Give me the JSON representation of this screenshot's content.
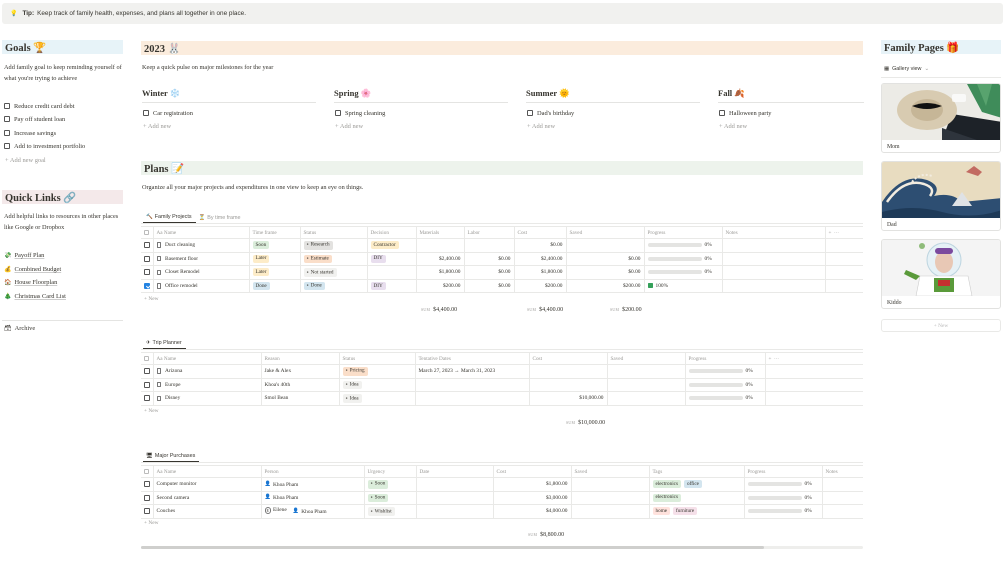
{
  "tip": {
    "icon": "💡",
    "label": "Tip:",
    "text": "Keep track of family health, expenses, and plans all together in one place."
  },
  "goals": {
    "title": "Goals 🏆",
    "description": "Add family goal to keep reminding yourself of what you're trying to achieve",
    "items": [
      "Reduce credit card debt",
      "Pay off student loan",
      "Increase savings",
      "Add to investment portfolio"
    ],
    "new_label": "+ Add new goal"
  },
  "quick_links": {
    "title": "Quick Links 🔗",
    "description": "Add helpful links to resources in other places like Google or Dropbox",
    "links": [
      {
        "icon": "💸",
        "label": "Payoff Plan"
      },
      {
        "icon": "💰",
        "label": "Combined Budget"
      },
      {
        "icon": "🏠",
        "label": "House Floorplan"
      },
      {
        "icon": "🎄",
        "label": "Christmas Card List"
      }
    ],
    "archive": {
      "icon": "🗃",
      "label": "Archive"
    }
  },
  "year": {
    "title": "2023 🐰",
    "description": "Keep a quick pulse on major milestones for the year",
    "seasons": [
      {
        "name": "Winter ❄️",
        "item": "Car registration",
        "add": "+ Add new"
      },
      {
        "name": "Spring 🌸",
        "item": "Spring cleaning",
        "add": "+ Add new"
      },
      {
        "name": "Summer 🌞",
        "item": "Dad's birthday",
        "add": "+ Add new"
      },
      {
        "name": "Fall 🍂",
        "item": "Halloween party",
        "add": "+ Add new"
      }
    ]
  },
  "plans": {
    "title": "Plans 📝",
    "description": "Organize all your major projects and expenditures in one view to keep an eye on things.",
    "tabs": [
      "Family Projects",
      "By time frame"
    ],
    "headers": [
      "Aa Name",
      "Time frame",
      "Status",
      "Decision",
      "Materials",
      "Labor",
      "Cost",
      "Saved",
      "Progress",
      "Notes"
    ],
    "rows": [
      {
        "name": "Duct cleaning",
        "time": "Soon",
        "status": "Research",
        "decision": "Contractor",
        "materials": "",
        "labor": "",
        "cost": "$0.00",
        "saved": "",
        "progress": "0%",
        "pct": 0,
        "checked": false
      },
      {
        "name": "Basement floor",
        "time": "Later",
        "status": "Estimate",
        "decision": "DIY",
        "materials": "$2,400.00",
        "labor": "$0.00",
        "cost": "$2,400.00",
        "saved": "$0.00",
        "progress": "0%",
        "pct": 0,
        "checked": false
      },
      {
        "name": "Closet Remodel",
        "time": "Later",
        "status": "Not started",
        "decision": "",
        "materials": "$1,800.00",
        "labor": "$0.00",
        "cost": "$1,800.00",
        "saved": "$0.00",
        "progress": "0%",
        "pct": 0,
        "checked": false
      },
      {
        "name": "Office remodel",
        "time": "Done",
        "status": "Done",
        "decision": "DIY",
        "materials": "$200.00",
        "labor": "$0.00",
        "cost": "$200.00",
        "saved": "$200.00",
        "progress": "100%",
        "pct": 100,
        "checked": true
      }
    ],
    "new_label": "+ New",
    "sum_label": "SUM",
    "sum_materials": "$4,400.00",
    "sum_cost": "$4,400.00",
    "sum_saved": "$200.00"
  },
  "trips": {
    "tab": "Trip Planner",
    "headers": [
      "Aa Name",
      "Reason",
      "Status",
      "Tentative Dates",
      "Cost",
      "Saved",
      "Progress"
    ],
    "rows": [
      {
        "name": "Arizona",
        "reason": "Jake & Alex",
        "status": "Pricing",
        "dates": "March 27, 2023 → March 31, 2023",
        "cost": "",
        "saved": "",
        "progress": "0%",
        "pct": 0
      },
      {
        "name": "Europe",
        "reason": "Khoa's 40th",
        "status": "Idea",
        "dates": "",
        "cost": "",
        "saved": "",
        "progress": "0%",
        "pct": 0
      },
      {
        "name": "Disney",
        "reason": "Smol Bean",
        "status": "Idea",
        "dates": "",
        "cost": "$10,000.00",
        "saved": "",
        "progress": "0%",
        "pct": 0
      }
    ],
    "new_label": "+ New",
    "sum_label": "SUM",
    "sum_cost": "$10,000.00"
  },
  "purchases": {
    "tab": "Major Purchases",
    "headers": [
      "Aa Name",
      "Person",
      "Urgency",
      "Date",
      "Cost",
      "Saved",
      "Tags",
      "Progress",
      "Notes"
    ],
    "rows": [
      {
        "name": "Computer monitor",
        "persons": [
          {
            "av": "",
            "name": "Khoa Pham"
          }
        ],
        "urgency": "Soon",
        "date": "",
        "cost": "$1,800.00",
        "saved": "",
        "tags": [
          {
            "t": "electronics",
            "c": "#dbeddb"
          },
          {
            "t": "office",
            "c": "#d3e5ef"
          }
        ],
        "progress": "0%",
        "pct": 0
      },
      {
        "name": "Second camera",
        "persons": [
          {
            "av": "",
            "name": "Khoa Pham"
          }
        ],
        "urgency": "Soon",
        "date": "",
        "cost": "$3,000.00",
        "saved": "",
        "tags": [
          {
            "t": "electronics",
            "c": "#dbeddb"
          }
        ],
        "progress": "0%",
        "pct": 0
      },
      {
        "name": "Couches",
        "persons": [
          {
            "av": "E",
            "name": "Eilene"
          },
          {
            "av": "",
            "name": "Khoa Pham"
          }
        ],
        "urgency": "Wishlist",
        "date": "",
        "cost": "$4,000.00",
        "saved": "",
        "tags": [
          {
            "t": "home",
            "c": "#ffe2dd"
          },
          {
            "t": "furniture",
            "c": "#f5e0e9"
          }
        ],
        "progress": "0%",
        "pct": 0
      }
    ],
    "new_label": "+ New",
    "sum_label": "SUM",
    "sum_cost": "$8,800.00"
  },
  "family_pages": {
    "title": "Family Pages 🎁",
    "view_label": "Gallery view",
    "cards": [
      "Mom",
      "Dad",
      "Kiddo"
    ],
    "new_label": "+ New"
  },
  "colors": {
    "goals_bg": "#e7f3f8",
    "year_bg": "#fbecdd",
    "plans_bg": "#edf3ec",
    "links_bg": "#f4e9ea",
    "family_bg": "#e7f3f8"
  }
}
